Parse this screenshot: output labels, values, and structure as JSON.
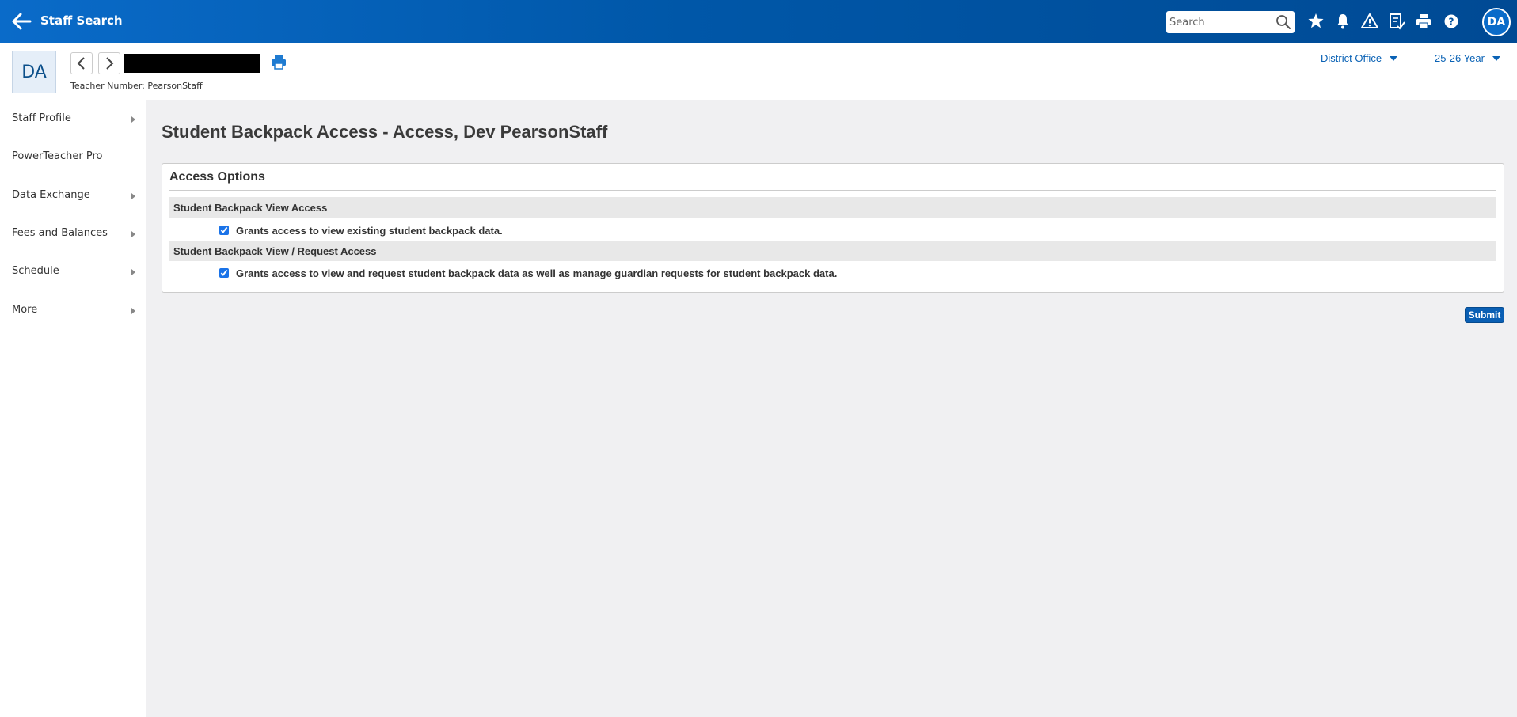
{
  "topbar": {
    "title": "Staff Search",
    "search_placeholder": "Search",
    "icons": [
      "back-arrow-icon",
      "search-icon",
      "star-icon",
      "bell-icon",
      "warning-icon",
      "checklist-icon",
      "print-icon",
      "help-icon"
    ],
    "user_initials": "DA"
  },
  "header": {
    "avatar_initials": "DA",
    "teacher_number_label": "Teacher Number: PearsonStaff",
    "school_selector": "District Office",
    "term_selector": "25-26 Year"
  },
  "sidebar": {
    "items": [
      {
        "label": "Staff Profile",
        "has_submenu": true
      },
      {
        "label": "PowerTeacher Pro",
        "has_submenu": false
      },
      {
        "label": "Data Exchange",
        "has_submenu": true
      },
      {
        "label": "Fees and Balances",
        "has_submenu": true
      },
      {
        "label": "Schedule",
        "has_submenu": true
      },
      {
        "label": "More",
        "has_submenu": true
      }
    ]
  },
  "main": {
    "page_title": "Student Backpack Access - Access, Dev PearsonStaff",
    "panel_title": "Access Options",
    "sections": [
      {
        "heading": "Student Backpack View Access",
        "option_label": "Grants access to view existing student backpack data.",
        "checked": true
      },
      {
        "heading": "Student Backpack View / Request Access",
        "option_label": "Grants access to view and request student backpack data as well as manage guardian requests for student backpack data.",
        "checked": true
      }
    ],
    "submit_label": "Submit"
  },
  "colors": {
    "topbar_start": "#0a6bc9",
    "topbar_end": "#004a94",
    "link_blue": "#0a62b5",
    "submit_blue": "#0a5fb4",
    "content_background": "#f0f0f2"
  }
}
